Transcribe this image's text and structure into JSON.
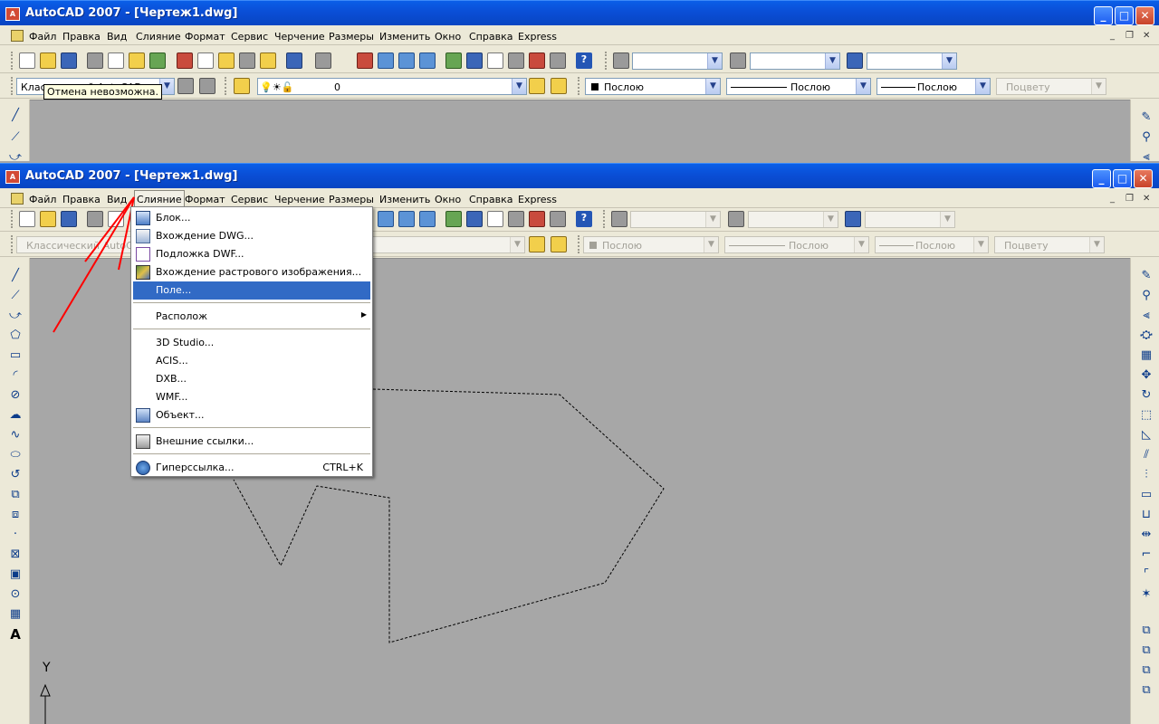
{
  "window_top": {
    "title": "AutoCAD 2007 - [Чертеж1.dwg]",
    "app_icon_text": "A",
    "menu": [
      "Файл",
      "Правка",
      "Вид",
      "Слияние",
      "Формат",
      "Сервис",
      "Черчение",
      "Размеры",
      "Изменить",
      "Окно",
      "Справка",
      "Express"
    ],
    "mdi": {
      "minimize": "_",
      "restore": "❐",
      "close": "✕"
    },
    "tooltip": "Отмена невозможна.",
    "workspace_value": "Классический AutoCAD",
    "layer_value": "0",
    "color_value": "Послою",
    "linetype_value": "Послою",
    "lineweight_value": "Послою",
    "plotstyle_value": "Поцвету"
  },
  "window_main": {
    "title": "AutoCAD 2007 - [Чертеж1.dwg]",
    "app_icon_text": "A",
    "menu": [
      "Файл",
      "Правка",
      "Вид",
      "Слияние",
      "Формат",
      "Сервис",
      "Черчение",
      "Размеры",
      "Изменить",
      "Окно",
      "Справка",
      "Express"
    ],
    "mdi": {
      "minimize": "_",
      "restore": "❐",
      "close": "✕"
    },
    "workspace_value": "Классический AutoCAD",
    "color_value": "Послою",
    "linetype_value": "Послою",
    "lineweight_value": "Послою",
    "plotstyle_value": "Поцвету"
  },
  "caption_buttons": {
    "minimize": "_",
    "maximize": "□",
    "close": "✕"
  },
  "help_glyph": "?",
  "combo_arrow": "▼",
  "insert_menu": {
    "items": [
      {
        "label": "Блок...",
        "icon": "block-icon"
      },
      {
        "label": "Вхождение DWG...",
        "icon": "dwg-reference-icon"
      },
      {
        "label": "Подложка DWF...",
        "icon": "dwf-underlay-icon"
      },
      {
        "label": "Вхождение растрового изображения...",
        "icon": "raster-image-icon"
      },
      {
        "label": "Поле...",
        "icon": "",
        "selected": true
      },
      {
        "label": "Располож",
        "submenu": true
      },
      {
        "label": "3D Studio..."
      },
      {
        "label": "ACIS..."
      },
      {
        "label": "DXB..."
      },
      {
        "label": "WMF..."
      },
      {
        "label": "Объект...",
        "icon": "ole-object-icon"
      },
      {
        "label": "Внешние ссылки...",
        "icon": "xref-icon"
      },
      {
        "label": "Гиперссылка...",
        "icon": "hyperlink-icon",
        "shortcut": "CTRL+K"
      }
    ],
    "submenu_arrow": "▶"
  },
  "left_tools": [
    "╱",
    "⟋",
    "⤻",
    "⬠",
    "▭",
    "◜",
    "⊘",
    "☁",
    "∿",
    "⬭",
    "↺",
    "⧉",
    "⧈",
    "·",
    "⊠",
    "▣",
    "⊙",
    "▦",
    "A"
  ],
  "right_tools": [
    "✎",
    "⚲",
    "⫷",
    "⛮",
    "▦",
    "✥",
    "↻",
    "⬚",
    "◺",
    "⫽",
    "⫶",
    "▭",
    "⊔",
    "⇹",
    "⌐",
    "⌜",
    "✶",
    "⧉",
    "⧉",
    "⧉",
    "⧉"
  ],
  "ucs_label": "Y",
  "colors": {
    "selection": "#316ac5",
    "titlebar": "#0a4ed6",
    "canvas": "#a7a7a7",
    "arrow": "#ff0000"
  }
}
